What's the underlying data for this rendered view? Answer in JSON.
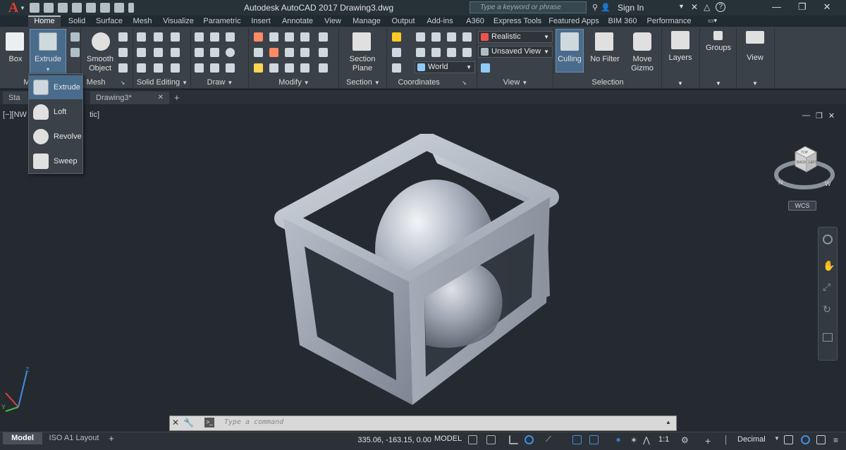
{
  "app": {
    "logo": "A",
    "title": "Autodesk AutoCAD 2017   Drawing3.dwg",
    "search_placeholder": "Type a keyword or phrase",
    "sign_in": "Sign In"
  },
  "ribbon_tabs": [
    "Home",
    "Solid",
    "Surface",
    "Mesh",
    "Visualize",
    "Parametric",
    "Insert",
    "Annotate",
    "View",
    "Manage",
    "Output",
    "Add-ins",
    "A360",
    "Express Tools",
    "Featured Apps",
    "BIM 360",
    "Performance"
  ],
  "ribbon": {
    "box_label": "Box",
    "extrude_label": "Extrude",
    "smooth_object_label_1": "Smooth",
    "smooth_object_label_2": "Object",
    "section_plane_label_1": "Section",
    "section_plane_label_2": "Plane",
    "culling_label": "Culling",
    "no_filter_label": "No Filter",
    "move_gizmo_label_1": "Move",
    "move_gizmo_label_2": "Gizmo",
    "layers_label": "Layers",
    "groups_label": "Groups",
    "view_label": "View",
    "visual_style": "Realistic",
    "named_view": "Unsaved View",
    "ucs": "World",
    "panels": {
      "modeling": "M",
      "mesh": "Mesh",
      "solid_editing": "Solid Editing",
      "draw": "Draw",
      "modify": "Modify",
      "section": "Section",
      "coordinates": "Coordinates",
      "view": "View",
      "selection": "Selection"
    }
  },
  "extrude_menu": {
    "items": [
      {
        "label": "Extrude",
        "icon": "extrude-icon"
      },
      {
        "label": "Loft",
        "icon": "loft-icon"
      },
      {
        "label": "Revolve",
        "icon": "revolve-icon"
      },
      {
        "label": "Sweep",
        "icon": "sweep-icon"
      }
    ]
  },
  "file_tabs": {
    "start": "Sta",
    "drawing": "Drawing3*"
  },
  "viewport": {
    "label_left": "[−][NW",
    "label_right": "tic]",
    "wcs": "WCS",
    "viewcube_top": "TOP",
    "viewcube_back": "BACK",
    "viewcube_left": "LEFT",
    "compass_n": "N",
    "compass_w": "W"
  },
  "command_line": {
    "placeholder": "Type a command"
  },
  "status": {
    "model_tab": "Model",
    "layout_tab": "ISO A1 Layout",
    "coordinates": "335.06, -163.15, 0.00",
    "model_button": "MODEL",
    "scale": "1:1",
    "units": "Decimal"
  },
  "colors": {
    "accent": "#4a6c8c",
    "logo_red": "#e03c31",
    "model_solid": "#a9b0bd"
  }
}
